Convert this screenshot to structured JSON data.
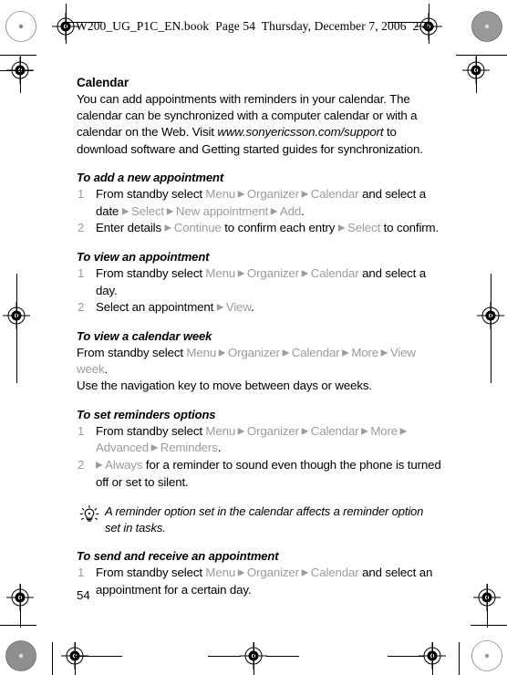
{
  "document": {
    "header_line": "W200_UG_P1C_EN.book  Page 54  Thursday, December 7, 2006  2:4",
    "page_number": "54"
  },
  "content": {
    "section_title": "Calendar",
    "intro_lines": [
      "You can add appointments with reminders in your",
      "calendar. The calendar can be synchronized with a",
      "computer calendar or with a calendar on the Web. Visit"
    ],
    "intro_url": "www.sonyericsson.com/support",
    "intro_tail_lines": [
      " to download software and",
      "Getting started guides for synchronization."
    ],
    "procedures": [
      {
        "title": "To add a new appointment",
        "steps": [
          {
            "number": "1",
            "parts": [
              {
                "t": "From standby select ",
                "ui": false
              },
              {
                "t": "Menu",
                "ui": true
              },
              {
                "t": "ARROW",
                "ui": true
              },
              {
                "t": "Organizer",
                "ui": true
              },
              {
                "t": "ARROW",
                "ui": true
              },
              {
                "t": "Calendar",
                "ui": true
              },
              {
                "t": " and select a date ",
                "ui": false
              },
              {
                "t": "ARROW",
                "ui": true
              },
              {
                "t": "Select",
                "ui": true
              },
              {
                "t": "ARROW",
                "ui": true
              },
              {
                "t": "New appointment",
                "ui": true
              },
              {
                "t": "ARROW",
                "ui": true
              },
              {
                "t": "Add",
                "ui": true
              },
              {
                "t": ".",
                "ui": false
              }
            ]
          },
          {
            "number": "2",
            "parts": [
              {
                "t": "Enter details ",
                "ui": false
              },
              {
                "t": "ARROW",
                "ui": true
              },
              {
                "t": "Continue",
                "ui": true
              },
              {
                "t": " to confirm each entry ",
                "ui": false
              },
              {
                "t": "ARROW",
                "ui": true
              },
              {
                "t": "Select",
                "ui": true
              },
              {
                "t": " to confirm.",
                "ui": false
              }
            ]
          }
        ]
      },
      {
        "title": "To view an appointment",
        "steps": [
          {
            "number": "1",
            "parts": [
              {
                "t": "From standby select ",
                "ui": false
              },
              {
                "t": "Menu",
                "ui": true
              },
              {
                "t": "ARROW",
                "ui": true
              },
              {
                "t": "Organizer",
                "ui": true
              },
              {
                "t": "ARROW",
                "ui": true
              },
              {
                "t": "Calendar",
                "ui": true
              },
              {
                "t": " and select a day.",
                "ui": false
              }
            ]
          },
          {
            "number": "2",
            "parts": [
              {
                "t": "Select an appointment ",
                "ui": false
              },
              {
                "t": "ARROW",
                "ui": true
              },
              {
                "t": "View",
                "ui": true
              },
              {
                "t": ".",
                "ui": false
              }
            ]
          }
        ]
      },
      {
        "title": "To view a calendar week",
        "paragraphs": [
          {
            "parts": [
              {
                "t": "From standby select ",
                "ui": false
              },
              {
                "t": "Menu",
                "ui": true
              },
              {
                "t": "ARROW",
                "ui": true
              },
              {
                "t": "Organizer",
                "ui": true
              },
              {
                "t": "ARROW",
                "ui": true
              },
              {
                "t": "Calendar",
                "ui": true
              },
              {
                "t": "ARROW",
                "ui": true
              },
              {
                "t": "More",
                "ui": true
              },
              {
                "t": "ARROW",
                "ui": true
              },
              {
                "t": "View week",
                "ui": true
              },
              {
                "t": ".",
                "ui": false
              }
            ]
          },
          {
            "parts": [
              {
                "t": "Use the navigation key to move between days or weeks.",
                "ui": false
              }
            ]
          }
        ]
      },
      {
        "title": "To set reminders options",
        "steps": [
          {
            "number": "1",
            "parts": [
              {
                "t": "From standby select ",
                "ui": false
              },
              {
                "t": "Menu",
                "ui": true
              },
              {
                "t": "ARROW",
                "ui": true
              },
              {
                "t": "Organizer",
                "ui": true
              },
              {
                "t": "ARROW",
                "ui": true
              },
              {
                "t": "Calendar",
                "ui": true
              },
              {
                "t": "ARROW",
                "ui": true
              },
              {
                "t": "More",
                "ui": true
              },
              {
                "t": "ARROW",
                "ui": true
              },
              {
                "t": "Advanced",
                "ui": true
              },
              {
                "t": "ARROW",
                "ui": true
              },
              {
                "t": "Reminders",
                "ui": true
              },
              {
                "t": ".",
                "ui": false
              }
            ]
          },
          {
            "number": "2",
            "parts": [
              {
                "t": "ARROW",
                "ui": true
              },
              {
                "t": "Always",
                "ui": true
              },
              {
                "t": " for a reminder to sound even though the phone is turned off or set to silent.",
                "ui": false
              }
            ]
          }
        ]
      }
    ],
    "tip": {
      "icon": "lightbulb-icon",
      "text": "A reminder option set in the calendar affects a reminder option set in tasks."
    },
    "final_procedure": {
      "title": "To send and receive an appointment",
      "steps": [
        {
          "number": "1",
          "parts": [
            {
              "t": "From standby select ",
              "ui": false
            },
            {
              "t": "Menu",
              "ui": true
            },
            {
              "t": "ARROW",
              "ui": true
            },
            {
              "t": "Organizer",
              "ui": true
            },
            {
              "t": "ARROW",
              "ui": true
            },
            {
              "t": "Calendar",
              "ui": true
            },
            {
              "t": " and select an appointment for a certain day.",
              "ui": false
            }
          ]
        }
      ]
    }
  },
  "print_marks": {
    "arrow_glyph": "▶",
    "ui_term_color": "#9c9c9c",
    "text_color": "#000000"
  }
}
